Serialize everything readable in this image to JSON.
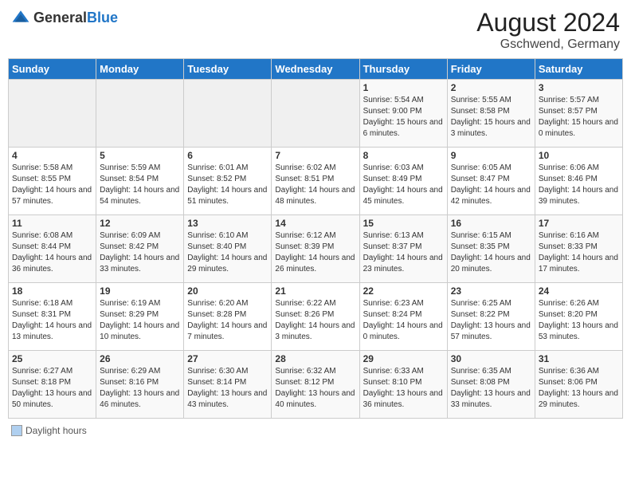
{
  "header": {
    "logo_general": "General",
    "logo_blue": "Blue",
    "month_year": "August 2024",
    "location": "Gschwend, Germany"
  },
  "days_of_week": [
    "Sunday",
    "Monday",
    "Tuesday",
    "Wednesday",
    "Thursday",
    "Friday",
    "Saturday"
  ],
  "weeks": [
    [
      {
        "day": "",
        "info": ""
      },
      {
        "day": "",
        "info": ""
      },
      {
        "day": "",
        "info": ""
      },
      {
        "day": "",
        "info": ""
      },
      {
        "day": "1",
        "info": "Sunrise: 5:54 AM\nSunset: 9:00 PM\nDaylight: 15 hours\nand 6 minutes."
      },
      {
        "day": "2",
        "info": "Sunrise: 5:55 AM\nSunset: 8:58 PM\nDaylight: 15 hours\nand 3 minutes."
      },
      {
        "day": "3",
        "info": "Sunrise: 5:57 AM\nSunset: 8:57 PM\nDaylight: 15 hours\nand 0 minutes."
      }
    ],
    [
      {
        "day": "4",
        "info": "Sunrise: 5:58 AM\nSunset: 8:55 PM\nDaylight: 14 hours\nand 57 minutes."
      },
      {
        "day": "5",
        "info": "Sunrise: 5:59 AM\nSunset: 8:54 PM\nDaylight: 14 hours\nand 54 minutes."
      },
      {
        "day": "6",
        "info": "Sunrise: 6:01 AM\nSunset: 8:52 PM\nDaylight: 14 hours\nand 51 minutes."
      },
      {
        "day": "7",
        "info": "Sunrise: 6:02 AM\nSunset: 8:51 PM\nDaylight: 14 hours\nand 48 minutes."
      },
      {
        "day": "8",
        "info": "Sunrise: 6:03 AM\nSunset: 8:49 PM\nDaylight: 14 hours\nand 45 minutes."
      },
      {
        "day": "9",
        "info": "Sunrise: 6:05 AM\nSunset: 8:47 PM\nDaylight: 14 hours\nand 42 minutes."
      },
      {
        "day": "10",
        "info": "Sunrise: 6:06 AM\nSunset: 8:46 PM\nDaylight: 14 hours\nand 39 minutes."
      }
    ],
    [
      {
        "day": "11",
        "info": "Sunrise: 6:08 AM\nSunset: 8:44 PM\nDaylight: 14 hours\nand 36 minutes."
      },
      {
        "day": "12",
        "info": "Sunrise: 6:09 AM\nSunset: 8:42 PM\nDaylight: 14 hours\nand 33 minutes."
      },
      {
        "day": "13",
        "info": "Sunrise: 6:10 AM\nSunset: 8:40 PM\nDaylight: 14 hours\nand 29 minutes."
      },
      {
        "day": "14",
        "info": "Sunrise: 6:12 AM\nSunset: 8:39 PM\nDaylight: 14 hours\nand 26 minutes."
      },
      {
        "day": "15",
        "info": "Sunrise: 6:13 AM\nSunset: 8:37 PM\nDaylight: 14 hours\nand 23 minutes."
      },
      {
        "day": "16",
        "info": "Sunrise: 6:15 AM\nSunset: 8:35 PM\nDaylight: 14 hours\nand 20 minutes."
      },
      {
        "day": "17",
        "info": "Sunrise: 6:16 AM\nSunset: 8:33 PM\nDaylight: 14 hours\nand 17 minutes."
      }
    ],
    [
      {
        "day": "18",
        "info": "Sunrise: 6:18 AM\nSunset: 8:31 PM\nDaylight: 14 hours\nand 13 minutes."
      },
      {
        "day": "19",
        "info": "Sunrise: 6:19 AM\nSunset: 8:29 PM\nDaylight: 14 hours\nand 10 minutes."
      },
      {
        "day": "20",
        "info": "Sunrise: 6:20 AM\nSunset: 8:28 PM\nDaylight: 14 hours\nand 7 minutes."
      },
      {
        "day": "21",
        "info": "Sunrise: 6:22 AM\nSunset: 8:26 PM\nDaylight: 14 hours\nand 3 minutes."
      },
      {
        "day": "22",
        "info": "Sunrise: 6:23 AM\nSunset: 8:24 PM\nDaylight: 14 hours\nand 0 minutes."
      },
      {
        "day": "23",
        "info": "Sunrise: 6:25 AM\nSunset: 8:22 PM\nDaylight: 13 hours\nand 57 minutes."
      },
      {
        "day": "24",
        "info": "Sunrise: 6:26 AM\nSunset: 8:20 PM\nDaylight: 13 hours\nand 53 minutes."
      }
    ],
    [
      {
        "day": "25",
        "info": "Sunrise: 6:27 AM\nSunset: 8:18 PM\nDaylight: 13 hours\nand 50 minutes."
      },
      {
        "day": "26",
        "info": "Sunrise: 6:29 AM\nSunset: 8:16 PM\nDaylight: 13 hours\nand 46 minutes."
      },
      {
        "day": "27",
        "info": "Sunrise: 6:30 AM\nSunset: 8:14 PM\nDaylight: 13 hours\nand 43 minutes."
      },
      {
        "day": "28",
        "info": "Sunrise: 6:32 AM\nSunset: 8:12 PM\nDaylight: 13 hours\nand 40 minutes."
      },
      {
        "day": "29",
        "info": "Sunrise: 6:33 AM\nSunset: 8:10 PM\nDaylight: 13 hours\nand 36 minutes."
      },
      {
        "day": "30",
        "info": "Sunrise: 6:35 AM\nSunset: 8:08 PM\nDaylight: 13 hours\nand 33 minutes."
      },
      {
        "day": "31",
        "info": "Sunrise: 6:36 AM\nSunset: 8:06 PM\nDaylight: 13 hours\nand 29 minutes."
      }
    ]
  ],
  "legend": {
    "label": "Daylight hours"
  }
}
